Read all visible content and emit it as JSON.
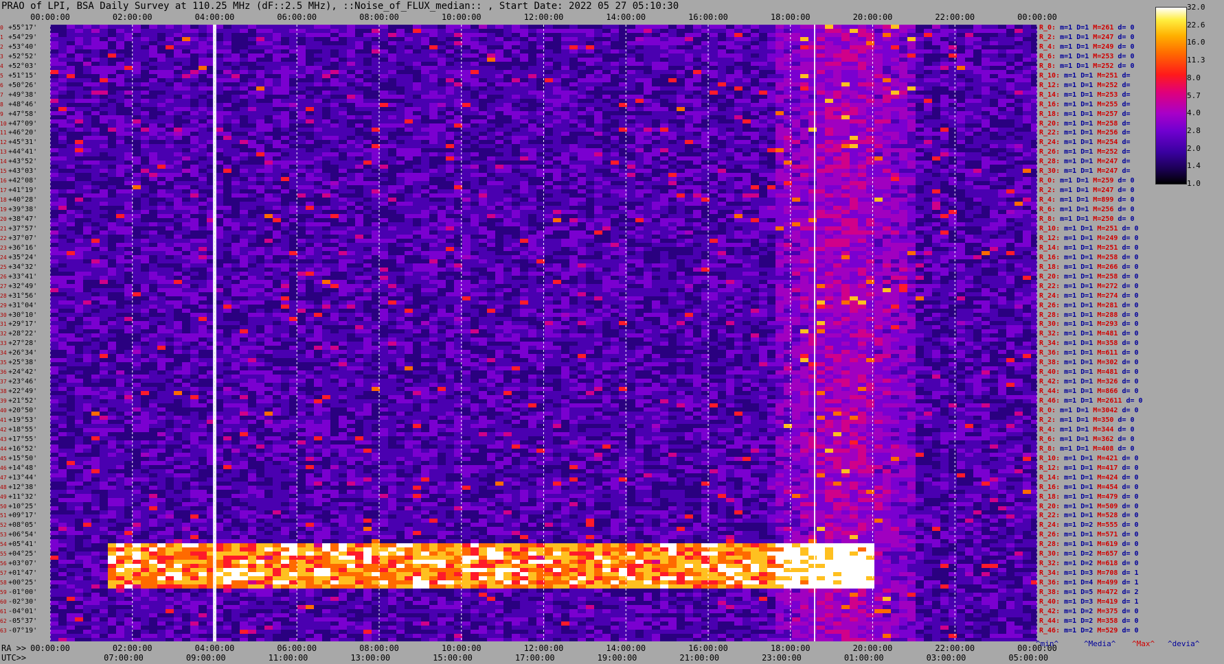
{
  "title": "PRAO of LPI, BSA Daily Survey at 110.25 MHz (dF::2.5 MHz), ::Noise_of_FLUX_median:: , Start Date: 2022 05 27 05:10:30",
  "chart_data": {
    "type": "heatmap",
    "title": "PRAO of LPI, BSA Daily Survey at 110.25 MHz (dF::2.5 MHz), ::Noise_of_FLUX_median:: , Start Date: 2022 05 27 05:10:30",
    "x_top_ticks": [
      "00:00:00",
      "02:00:00",
      "04:00:00",
      "06:00:00",
      "08:00:00",
      "10:00:00",
      "12:00:00",
      "14:00:00",
      "16:00:00",
      "18:00:00",
      "20:00:00",
      "22:00:00",
      "00:00:00"
    ],
    "x_bottom_ra_label": "RA >>",
    "x_bottom_ra_ticks": [
      "00:00:00",
      "02:00:00",
      "04:00:00",
      "06:00:00",
      "08:00:00",
      "10:00:00",
      "12:00:00",
      "14:00:00",
      "16:00:00",
      "18:00:00",
      "20:00:00",
      "22:00:00",
      "00:00:00"
    ],
    "x_bottom_utc_label": "UTC>>",
    "x_bottom_utc_ticks": [
      "07:00:00",
      "09:00:00",
      "11:00:00",
      "13:00:00",
      "15:00:00",
      "17:00:00",
      "19:00:00",
      "21:00:00",
      "23:00:00",
      "01:00:00",
      "03:00:00",
      "05:00:00"
    ],
    "y_ticks": [
      "+55°17'",
      "+54°29'",
      "+53°40'",
      "+52°52'",
      "+52°03'",
      "+51°15'",
      "+50°26'",
      "+49°38'",
      "+48°46'",
      "+47°58'",
      "+47°09'",
      "+46°20'",
      "+45°31'",
      "+44°41'",
      "+43°52'",
      "+43°03'",
      "+42°08'",
      "+41°19'",
      "+40°28'",
      "+39°38'",
      "+38°47'",
      "+37°57'",
      "+37°07'",
      "+36°16'",
      "+35°24'",
      "+34°32'",
      "+33°41'",
      "+32°49'",
      "+31°56'",
      "+31°04'",
      "+30°10'",
      "+29°17'",
      "+28°22'",
      "+27°28'",
      "+26°34'",
      "+25°38'",
      "+24°42'",
      "+23°46'",
      "+22°49'",
      "+21°52'",
      "+20°50'",
      "+19°53'",
      "+18°55'",
      "+17°55'",
      "+16°52'",
      "+15°50'",
      "+14°48'",
      "+13°44'",
      "+12°38'",
      "+11°32'",
      "+10°25'",
      "+09°17'",
      "+08°05'",
      "+06°54'",
      "+05°41'",
      "+04°25'",
      "+03°07'",
      "+01°47'",
      "+00°25'",
      "-01°00'",
      "-02°30'",
      "-04°01'",
      "-05°37'",
      "-07°19'"
    ],
    "y_index": [
      "0",
      "1",
      "2",
      "3",
      "4",
      "5",
      "6",
      "7",
      "8",
      "9",
      "10",
      "11",
      "12",
      "13",
      "14",
      "15",
      "16",
      "17",
      "18",
      "19",
      "20",
      "21",
      "22",
      "23",
      "24",
      "25",
      "26",
      "27",
      "28",
      "29",
      "30",
      "31",
      "32",
      "33",
      "34",
      "35",
      "36",
      "37",
      "38",
      "39",
      "40",
      "41",
      "42",
      "43",
      "44",
      "45",
      "46",
      "47",
      "48",
      "49",
      "50",
      "51",
      "52",
      "53",
      "54",
      "55",
      "56",
      "57",
      "58",
      "59",
      "60",
      "61",
      "62",
      "63"
    ],
    "colorbar": {
      "ticks": [
        "32.0",
        "22.6",
        "16.0",
        "11.3",
        "8.0",
        "5.7",
        "4.0",
        "2.8",
        "2.0",
        "1.4",
        "1.0"
      ],
      "scale": "log"
    },
    "row_stats": [
      {
        "r": "R_0:",
        "m": "m=1",
        "d": "D=1",
        "M": "M=261",
        "dev": "d= 0"
      },
      {
        "r": "R_2:",
        "m": "m=1",
        "d": "D=1",
        "M": "M=247",
        "dev": "d= 0"
      },
      {
        "r": "R_4:",
        "m": "m=1",
        "d": "D=1",
        "M": "M=249",
        "dev": "d= 0"
      },
      {
        "r": "R_6:",
        "m": "m=1",
        "d": "D=1",
        "M": "M=253",
        "dev": "d= 0"
      },
      {
        "r": "R_8:",
        "m": "m=1",
        "d": "D=1",
        "M": "M=252",
        "dev": "d= 0"
      },
      {
        "r": "R_10:",
        "m": "m=1",
        "d": "D=1",
        "M": "M=251",
        "dev": "d="
      },
      {
        "r": "R_12:",
        "m": "m=1",
        "d": "D=1",
        "M": "M=252",
        "dev": "d="
      },
      {
        "r": "R_14:",
        "m": "m=1",
        "d": "D=1",
        "M": "M=253",
        "dev": "d="
      },
      {
        "r": "R_16:",
        "m": "m=1",
        "d": "D=1",
        "M": "M=255",
        "dev": "d="
      },
      {
        "r": "R_18:",
        "m": "m=1",
        "d": "D=1",
        "M": "M=257",
        "dev": "d="
      },
      {
        "r": "R_20:",
        "m": "m=1",
        "d": "D=1",
        "M": "M=258",
        "dev": "d="
      },
      {
        "r": "R_22:",
        "m": "m=1",
        "d": "D=1",
        "M": "M=256",
        "dev": "d="
      },
      {
        "r": "R_24:",
        "m": "m=1",
        "d": "D=1",
        "M": "M=254",
        "dev": "d="
      },
      {
        "r": "R_26:",
        "m": "m=1",
        "d": "D=1",
        "M": "M=252",
        "dev": "d="
      },
      {
        "r": "R_28:",
        "m": "m=1",
        "d": "D=1",
        "M": "M=247",
        "dev": "d="
      },
      {
        "r": "R_30:",
        "m": "m=1",
        "d": "D=1",
        "M": "M=247",
        "dev": "d="
      },
      {
        "r": "R_0:",
        "m": "m=1",
        "d": "D=1",
        "M": "M=259",
        "dev": "d= 0"
      },
      {
        "r": "R_2:",
        "m": "m=1",
        "d": "D=1",
        "M": "M=247",
        "dev": "d= 0"
      },
      {
        "r": "R_4:",
        "m": "m=1",
        "d": "D=1",
        "M": "M=899",
        "dev": "d= 0"
      },
      {
        "r": "R_6:",
        "m": "m=1",
        "d": "D=1",
        "M": "M=256",
        "dev": "d= 0"
      },
      {
        "r": "R_8:",
        "m": "m=1",
        "d": "D=1",
        "M": "M=250",
        "dev": "d= 0"
      },
      {
        "r": "R_10:",
        "m": "m=1",
        "d": "D=1",
        "M": "M=251",
        "dev": "d= 0"
      },
      {
        "r": "R_12:",
        "m": "m=1",
        "d": "D=1",
        "M": "M=249",
        "dev": "d= 0"
      },
      {
        "r": "R_14:",
        "m": "m=1",
        "d": "D=1",
        "M": "M=251",
        "dev": "d= 0"
      },
      {
        "r": "R_16:",
        "m": "m=1",
        "d": "D=1",
        "M": "M=258",
        "dev": "d= 0"
      },
      {
        "r": "R_18:",
        "m": "m=1",
        "d": "D=1",
        "M": "M=266",
        "dev": "d= 0"
      },
      {
        "r": "R_20:",
        "m": "m=1",
        "d": "D=1",
        "M": "M=258",
        "dev": "d= 0"
      },
      {
        "r": "R_22:",
        "m": "m=1",
        "d": "D=1",
        "M": "M=272",
        "dev": "d= 0"
      },
      {
        "r": "R_24:",
        "m": "m=1",
        "d": "D=1",
        "M": "M=274",
        "dev": "d= 0"
      },
      {
        "r": "R_26:",
        "m": "m=1",
        "d": "D=1",
        "M": "M=281",
        "dev": "d= 0"
      },
      {
        "r": "R_28:",
        "m": "m=1",
        "d": "D=1",
        "M": "M=288",
        "dev": "d= 0"
      },
      {
        "r": "R_30:",
        "m": "m=1",
        "d": "D=1",
        "M": "M=293",
        "dev": "d= 0"
      },
      {
        "r": "R_32:",
        "m": "m=1",
        "d": "D=1",
        "M": "M=481",
        "dev": "d= 0"
      },
      {
        "r": "R_34:",
        "m": "m=1",
        "d": "D=1",
        "M": "M=358",
        "dev": "d= 0"
      },
      {
        "r": "R_36:",
        "m": "m=1",
        "d": "D=1",
        "M": "M=611",
        "dev": "d= 0"
      },
      {
        "r": "R_38:",
        "m": "m=1",
        "d": "D=1",
        "M": "M=302",
        "dev": "d= 0"
      },
      {
        "r": "R_40:",
        "m": "m=1",
        "d": "D=1",
        "M": "M=481",
        "dev": "d= 0"
      },
      {
        "r": "R_42:",
        "m": "m=1",
        "d": "D=1",
        "M": "M=326",
        "dev": "d= 0"
      },
      {
        "r": "R_44:",
        "m": "m=1",
        "d": "D=1",
        "M": "M=866",
        "dev": "d= 0"
      },
      {
        "r": "R_46:",
        "m": "m=1",
        "d": "D=1",
        "M": "M=2611",
        "dev": "d= 0"
      },
      {
        "r": "R_0:",
        "m": "m=1",
        "d": "D=1",
        "M": "M=3042",
        "dev": "d= 0"
      },
      {
        "r": "R_2:",
        "m": "m=1",
        "d": "D=1",
        "M": "M=350",
        "dev": "d= 0"
      },
      {
        "r": "R_4:",
        "m": "m=1",
        "d": "D=1",
        "M": "M=344",
        "dev": "d= 0"
      },
      {
        "r": "R_6:",
        "m": "m=1",
        "d": "D=1",
        "M": "M=362",
        "dev": "d= 0"
      },
      {
        "r": "R_8:",
        "m": "m=1",
        "d": "D=1",
        "M": "M=408",
        "dev": "d= 0"
      },
      {
        "r": "R_10:",
        "m": "m=1",
        "d": "D=1",
        "M": "M=421",
        "dev": "d= 0"
      },
      {
        "r": "R_12:",
        "m": "m=1",
        "d": "D=1",
        "M": "M=417",
        "dev": "d= 0"
      },
      {
        "r": "R_14:",
        "m": "m=1",
        "d": "D=1",
        "M": "M=424",
        "dev": "d= 0"
      },
      {
        "r": "R_16:",
        "m": "m=1",
        "d": "D=1",
        "M": "M=454",
        "dev": "d= 0"
      },
      {
        "r": "R_18:",
        "m": "m=1",
        "d": "D=1",
        "M": "M=479",
        "dev": "d= 0"
      },
      {
        "r": "R_20:",
        "m": "m=1",
        "d": "D=1",
        "M": "M=509",
        "dev": "d= 0"
      },
      {
        "r": "R_22:",
        "m": "m=1",
        "d": "D=1",
        "M": "M=528",
        "dev": "d= 0"
      },
      {
        "r": "R_24:",
        "m": "m=1",
        "d": "D=2",
        "M": "M=555",
        "dev": "d= 0"
      },
      {
        "r": "R_26:",
        "m": "m=1",
        "d": "D=1",
        "M": "M=571",
        "dev": "d= 0"
      },
      {
        "r": "R_28:",
        "m": "m=1",
        "d": "D=1",
        "M": "M=619",
        "dev": "d= 0"
      },
      {
        "r": "R_30:",
        "m": "m=1",
        "d": "D=2",
        "M": "M=657",
        "dev": "d= 0"
      },
      {
        "r": "R_32:",
        "m": "m=1",
        "d": "D=2",
        "M": "M=618",
        "dev": "d= 0"
      },
      {
        "r": "R_34:",
        "m": "m=1",
        "d": "D=3",
        "M": "M=708",
        "dev": "d= 1"
      },
      {
        "r": "R_36:",
        "m": "m=1",
        "d": "D=4",
        "M": "M=499",
        "dev": "d= 1"
      },
      {
        "r": "R_38:",
        "m": "m=1",
        "d": "D=5",
        "M": "M=472",
        "dev": "d= 2"
      },
      {
        "r": "R_40:",
        "m": "m=1",
        "d": "D=3",
        "M": "M=419",
        "dev": "d= 1"
      },
      {
        "r": "R_42:",
        "m": "m=1",
        "d": "D=2",
        "M": "M=375",
        "dev": "d= 0"
      },
      {
        "r": "R_44:",
        "m": "m=1",
        "d": "D=2",
        "M": "M=358",
        "dev": "d= 0"
      },
      {
        "r": "R_46:",
        "m": "m=1",
        "d": "D=2",
        "M": "M=529",
        "dev": "d= 0"
      }
    ],
    "legend": [
      "^min^",
      "^Media^",
      "^Max^",
      "^devia^"
    ]
  },
  "colors": {
    "background": "#a8a8a8",
    "stat_label": "#d00000",
    "stat_value": "#00009a"
  }
}
